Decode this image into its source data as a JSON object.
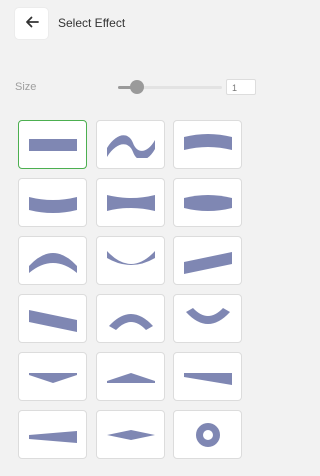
{
  "header": {
    "title": "Select Effect",
    "back_icon": "arrow-left-icon"
  },
  "size": {
    "label": "Size",
    "value": "1",
    "level": 0.18
  },
  "colors": {
    "shape": "#7f87b3",
    "selected_border": "#4caf50"
  },
  "effects": [
    {
      "name": "effect-straight-bar",
      "shape": "rect",
      "selected": true
    },
    {
      "name": "effect-wave",
      "shape": "wave"
    },
    {
      "name": "effect-arch-top",
      "shape": "arch-top"
    },
    {
      "name": "effect-curve-bottom",
      "shape": "curve-bottom"
    },
    {
      "name": "effect-pinch",
      "shape": "pinch"
    },
    {
      "name": "effect-bulge",
      "shape": "bulge"
    },
    {
      "name": "effect-arc-up",
      "shape": "arc-up"
    },
    {
      "name": "effect-arc-down",
      "shape": "arc-down"
    },
    {
      "name": "effect-slant-up",
      "shape": "slant-up"
    },
    {
      "name": "effect-slant-down",
      "shape": "slant-down"
    },
    {
      "name": "effect-small-arc-up",
      "shape": "small-arc-up"
    },
    {
      "name": "effect-small-arc-down",
      "shape": "small-arc-down"
    },
    {
      "name": "effect-triangle-down",
      "shape": "tri-down"
    },
    {
      "name": "effect-triangle-up",
      "shape": "tri-up"
    },
    {
      "name": "effect-wedge-right",
      "shape": "wedge-right"
    },
    {
      "name": "effect-wedge-left",
      "shape": "wedge-left"
    },
    {
      "name": "effect-diamond",
      "shape": "diamond"
    },
    {
      "name": "effect-ring",
      "shape": "ring"
    }
  ]
}
